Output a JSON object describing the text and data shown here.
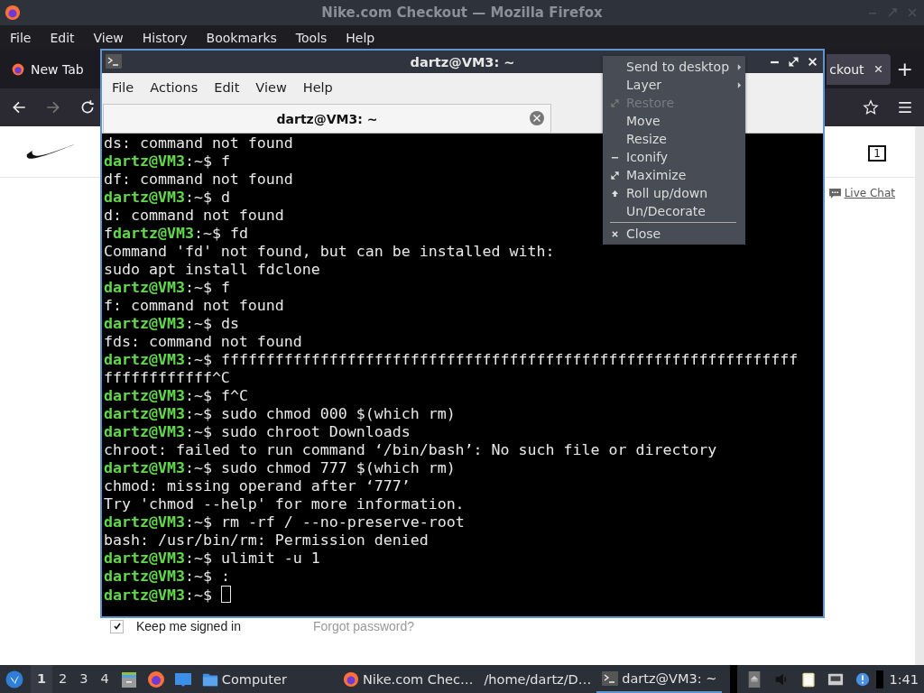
{
  "firefox": {
    "title": "Nike.com Checkout — Mozilla Firefox",
    "menu": [
      "File",
      "Edit",
      "View",
      "History",
      "Bookmarks",
      "Tools",
      "Help"
    ],
    "tabs": [
      {
        "label": "New Tab",
        "selected": false
      },
      {
        "label": "ckout",
        "selected": true
      }
    ],
    "new_tab": "+",
    "nav": {
      "forward_disabled": true
    },
    "page": {
      "bag_count": "1",
      "live_chat": "Live Chat",
      "keep_signed_in": {
        "label": "Keep me signed in",
        "checked": true
      },
      "forgot": "Forgot password?"
    }
  },
  "terminal": {
    "title": "dartz@VM3: ~",
    "menu": [
      "File",
      "Actions",
      "Edit",
      "View",
      "Help"
    ],
    "tab": "dartz@VM3: ~",
    "lines": [
      {
        "kind": "output",
        "text": "ds: command not found"
      },
      {
        "kind": "prompt",
        "user": "dartz@VM3",
        "path": ":~$",
        "command": "f"
      },
      {
        "kind": "output",
        "text": "df: command not found"
      },
      {
        "kind": "prompt",
        "user": "dartz@VM3",
        "path": ":~$",
        "command": "d"
      },
      {
        "kind": "output",
        "text": "d: command not found"
      },
      {
        "kind": "prompt",
        "prefix": "f",
        "user": "dartz@VM3",
        "path": ":~$",
        "command": "fd"
      },
      {
        "kind": "output",
        "text": "Command 'fd' not found, but can be installed with:"
      },
      {
        "kind": "output",
        "text": "sudo apt install fdclone"
      },
      {
        "kind": "prompt",
        "user": "dartz@VM3",
        "path": ":~$",
        "command": "f"
      },
      {
        "kind": "output",
        "text": "f: command not found"
      },
      {
        "kind": "prompt",
        "user": "dartz@VM3",
        "path": ":~$",
        "command": "ds"
      },
      {
        "kind": "output",
        "text": "fds: command not found"
      },
      {
        "kind": "prompt",
        "user": "dartz@VM3",
        "path": ":~$",
        "command": "ffffffffffffffffffffffffffffffffffffffffffffffffffffffffffffffff"
      },
      {
        "kind": "output",
        "text": "ffffffffffff^C"
      },
      {
        "kind": "prompt",
        "user": "dartz@VM3",
        "path": ":~$",
        "command": "f^C"
      },
      {
        "kind": "prompt",
        "user": "dartz@VM3",
        "path": ":~$",
        "command": "sudo chmod 000 $(which rm)"
      },
      {
        "kind": "prompt",
        "user": "dartz@VM3",
        "path": ":~$",
        "command": "sudo chroot Downloads"
      },
      {
        "kind": "output",
        "text": "chroot: failed to run command ‘/bin/bash’: No such file or directory"
      },
      {
        "kind": "prompt",
        "user": "dartz@VM3",
        "path": ":~$",
        "command": "sudo chmod 777 $(which rm)"
      },
      {
        "kind": "output",
        "text": "chmod: missing operand after ‘777’"
      },
      {
        "kind": "output",
        "text": "Try 'chmod --help' for more information."
      },
      {
        "kind": "prompt",
        "user": "dartz@VM3",
        "path": ":~$",
        "command": "rm -rf / --no-preserve-root"
      },
      {
        "kind": "output",
        "text": "bash: /usr/bin/rm: Permission denied"
      },
      {
        "kind": "prompt",
        "user": "dartz@VM3",
        "path": ":~$",
        "command": "ulimit -u 1"
      },
      {
        "kind": "prompt",
        "user": "dartz@VM3",
        "path": ":~$",
        "command": ":"
      },
      {
        "kind": "prompt",
        "user": "dartz@VM3",
        "path": ":~$",
        "cursor": true
      }
    ]
  },
  "window_menu": [
    {
      "label": "Send to desktop",
      "disabled": false,
      "submenu": true
    },
    {
      "label": "Layer",
      "disabled": false,
      "submenu": true
    },
    {
      "label": "Restore",
      "disabled": true,
      "submenu": false
    },
    {
      "label": "Move",
      "disabled": false,
      "submenu": false
    },
    {
      "label": "Resize",
      "disabled": false,
      "submenu": false
    },
    {
      "label": "Iconify",
      "disabled": false,
      "submenu": false
    },
    {
      "label": "Maximize",
      "disabled": false,
      "submenu": false
    },
    {
      "label": "Roll up/down",
      "disabled": false,
      "submenu": false
    },
    {
      "label": "Un/Decorate",
      "disabled": false,
      "submenu": false
    },
    {
      "label": "Close",
      "disabled": false,
      "submenu": false,
      "separator_before": true
    }
  ],
  "taskbar": {
    "workspaces": [
      {
        "label": "1",
        "selected": true
      },
      {
        "label": "2",
        "selected": false
      },
      {
        "label": "3",
        "selected": false
      },
      {
        "label": "4",
        "selected": false
      }
    ],
    "tasks": [
      {
        "label": "Computer",
        "kind": "folder",
        "selected": false
      },
      {
        "label": "Nike.com Chec…",
        "kind": "firefox",
        "selected": false
      },
      {
        "label": "/home/dartz/D…",
        "kind": "plain",
        "selected": false
      },
      {
        "label": "dartz@VM3: ~",
        "kind": "terminal",
        "selected": true
      }
    ],
    "clock": "1:41"
  }
}
